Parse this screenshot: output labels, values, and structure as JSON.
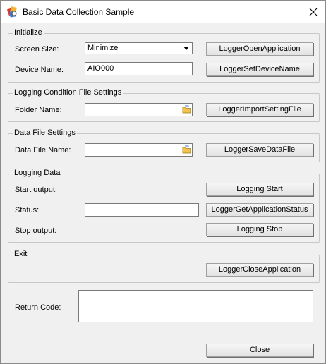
{
  "window": {
    "title": "Basic Data Collection Sample",
    "icon": "app-icon",
    "close_icon": "close-icon"
  },
  "initialize": {
    "legend": "Initialize",
    "screen_size_label": "Screen Size:",
    "screen_size_value": "Minimize",
    "device_name_label": "Device Name:",
    "device_name_value": "AIO000",
    "open_button": "LoggerOpenApplication",
    "set_device_button": "LoggerSetDeviceName"
  },
  "logging_condition": {
    "legend": "Logging Condition File Settings",
    "folder_label": "Folder Name:",
    "folder_value": "",
    "import_button": "LoggerImportSettingFile"
  },
  "data_file": {
    "legend": "Data File Settings",
    "file_label": "Data File Name:",
    "file_value": "",
    "save_button": "LoggerSaveDataFile"
  },
  "logging_data": {
    "legend": "Logging Data",
    "start_label": "Start output:",
    "start_button": "Logging Start",
    "status_label": "Status:",
    "status_value": "",
    "status_button": "LoggerGetApplicationStatus",
    "stop_label": "Stop output:",
    "stop_button": "Logging Stop"
  },
  "exit": {
    "legend": "Exit",
    "close_app_button": "LoggerCloseApplication"
  },
  "return_code": {
    "label": "Return Code:",
    "value": ""
  },
  "close_button": "Close"
}
